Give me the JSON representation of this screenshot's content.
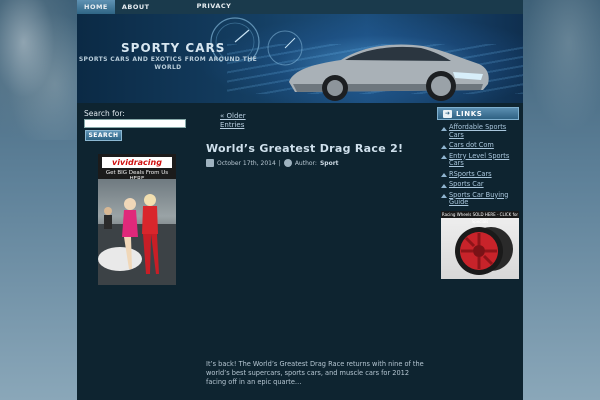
{
  "nav": {
    "items": [
      {
        "label": "HOME"
      },
      {
        "label": "ABOUT"
      },
      {
        "label": "PRIVACY POLICY"
      }
    ]
  },
  "header": {
    "title": "SPORTY CARS",
    "description": "SPORTS CARS AND EXOTICS FROM AROUND THE WORLD"
  },
  "search": {
    "label": "Search for:",
    "value": "",
    "button_label": "SEARCH"
  },
  "ad_left": {
    "brand": "vividracing",
    "tagline": "Get BIG Deals From Us HERE"
  },
  "main": {
    "older_link": "« Older Entries",
    "post": {
      "title": "World’s Greatest Drag Race 2!",
      "date": "October 17th, 2014",
      "separator": "|",
      "author_prefix": "Author:",
      "author": "Sport",
      "excerpt": "It’s back! The World’s Greatest Drag Race returns with nine of the world’s best supercars, sports cars, and muscle cars for 2012 facing off in an epic quarte…"
    }
  },
  "links": {
    "title": "LINKS",
    "items": [
      {
        "label": "Affordable Sports Cars"
      },
      {
        "label": "Cars dot Com"
      },
      {
        "label": "Entry Level Sports Cars"
      },
      {
        "label": "RSports Cars"
      },
      {
        "label": "Sports Car"
      },
      {
        "label": "Sports Car Buying Guide"
      }
    ]
  },
  "ad_right": {
    "banner": "Racing Wheels SOLD HERE - CLICK for Specials"
  },
  "colors": {
    "page_bg": "#0e2430",
    "accent": "#2f6283",
    "link": "#a9c6dc"
  }
}
